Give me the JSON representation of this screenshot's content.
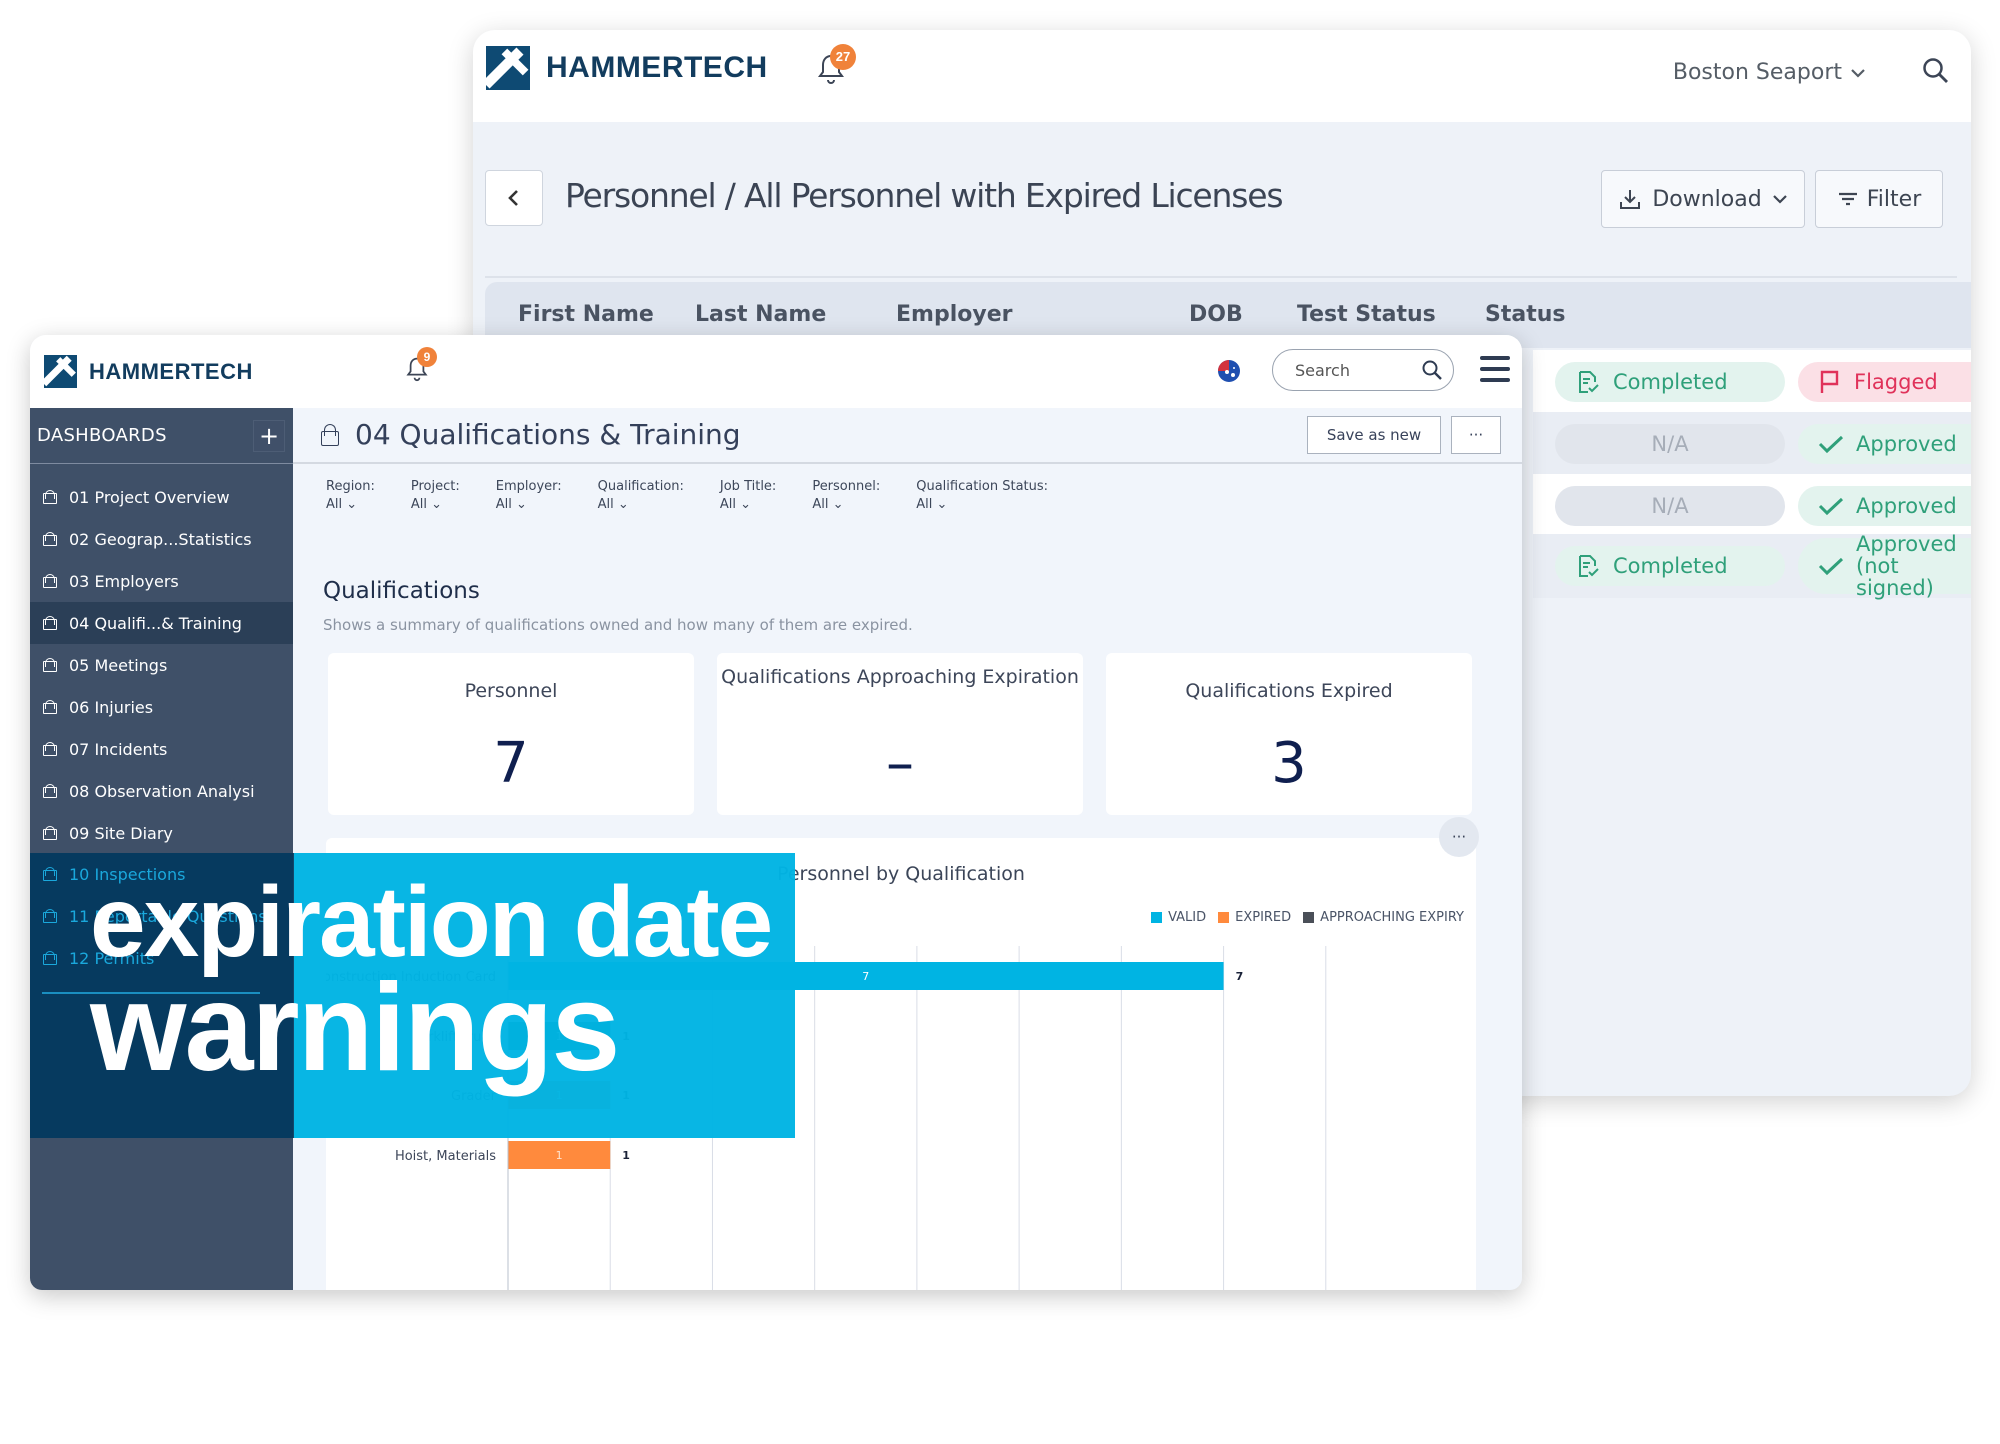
{
  "back_window": {
    "brand": "HAMMERTECH",
    "notification_count": "27",
    "project_selector": "Boston Seaport",
    "icons": {
      "back": "chevron-left-icon",
      "search": "search-icon",
      "download": "download-icon",
      "filter": "filter-icon",
      "bell": "bell-icon",
      "dropdown": "chevron-down-icon"
    },
    "page_title": "Personnel / All Personnel with Expired Licenses",
    "download_label": "Download",
    "filter_label": "Filter",
    "table": {
      "columns": [
        "First Name",
        "Last Name",
        "Employer",
        "DOB",
        "Test Status",
        "Status"
      ],
      "rows": [
        {
          "test_status": "Completed",
          "test_kind": "green",
          "status": "Flagged",
          "status_kind": "red"
        },
        {
          "test_status": "N/A",
          "test_kind": "grey",
          "status": "Approved",
          "status_kind": "green"
        },
        {
          "test_status": "N/A",
          "test_kind": "grey",
          "status": "Approved",
          "status_kind": "green"
        },
        {
          "test_status": "Completed",
          "test_kind": "green",
          "status": "Approved (not signed)",
          "status_kind": "green"
        }
      ]
    }
  },
  "front_window": {
    "brand": "HAMMERTECH",
    "notification_count": "9",
    "region_flag": "australia-flag-icon",
    "search_placeholder": "Search",
    "sidebar": {
      "title": "DASHBOARDS",
      "add_label": "+",
      "items": [
        {
          "label": "01 Project Overview",
          "active": false
        },
        {
          "label": "02 Geograp...Statistics",
          "active": false
        },
        {
          "label": "03 Employers",
          "active": false
        },
        {
          "label": "04 Qualifi...& Training",
          "active": true
        },
        {
          "label": "05 Meetings",
          "active": false
        },
        {
          "label": "06 Injuries",
          "active": false
        },
        {
          "label": "07 Incidents",
          "active": false
        },
        {
          "label": "08 Observation Analysi",
          "active": false
        },
        {
          "label": "09 Site Diary",
          "active": false
        },
        {
          "label": "10 Inspections",
          "active": false
        },
        {
          "label": "11 Reportable Questions",
          "active": false
        },
        {
          "label": "12 Permits",
          "active": false
        }
      ]
    },
    "dashboard_title": "04 Qualifications & Training",
    "save_as_new_label": "Save as new",
    "more_label": "···",
    "filters": [
      {
        "label": "Region:",
        "value": "All"
      },
      {
        "label": "Project:",
        "value": "All"
      },
      {
        "label": "Employer:",
        "value": "All"
      },
      {
        "label": "Qualification:",
        "value": "All"
      },
      {
        "label": "Job Title:",
        "value": "All"
      },
      {
        "label": "Personnel:",
        "value": "All"
      },
      {
        "label": "Qualification Status:",
        "value": "All"
      }
    ],
    "section": {
      "title": "Qualifications",
      "description": "Shows a summary of qualifications owned and how many of them are expired."
    },
    "kpis": [
      {
        "label": "Personnel",
        "value": "7"
      },
      {
        "label": "Qualifications Approaching Expiration",
        "value": "–"
      },
      {
        "label": "Qualifications Expired",
        "value": "3"
      }
    ],
    "chart_more_label": "···"
  },
  "overlay": {
    "line1": "expiration date",
    "line2": "warnings"
  },
  "chart_data": {
    "type": "bar",
    "orientation": "horizontal",
    "stacked": true,
    "title": "Personnel by Qualification",
    "categories": [
      "Construction Induction Card",
      "Forklift Truck",
      "Grader",
      "Hoist, Materials"
    ],
    "series": [
      {
        "name": "VALID",
        "color": "#00b4e3",
        "values": [
          7,
          0,
          0,
          0
        ]
      },
      {
        "name": "EXPIRED",
        "color": "#ff8a3d",
        "values": [
          0,
          0,
          1,
          1
        ]
      },
      {
        "name": "APPROACHING EXPIRY",
        "color": "#4a4f58",
        "values": [
          0,
          1,
          0,
          0
        ]
      }
    ],
    "totals": [
      7,
      1,
      1,
      1
    ],
    "xlim": [
      0,
      8
    ],
    "grid": true,
    "legend": "top-right"
  }
}
